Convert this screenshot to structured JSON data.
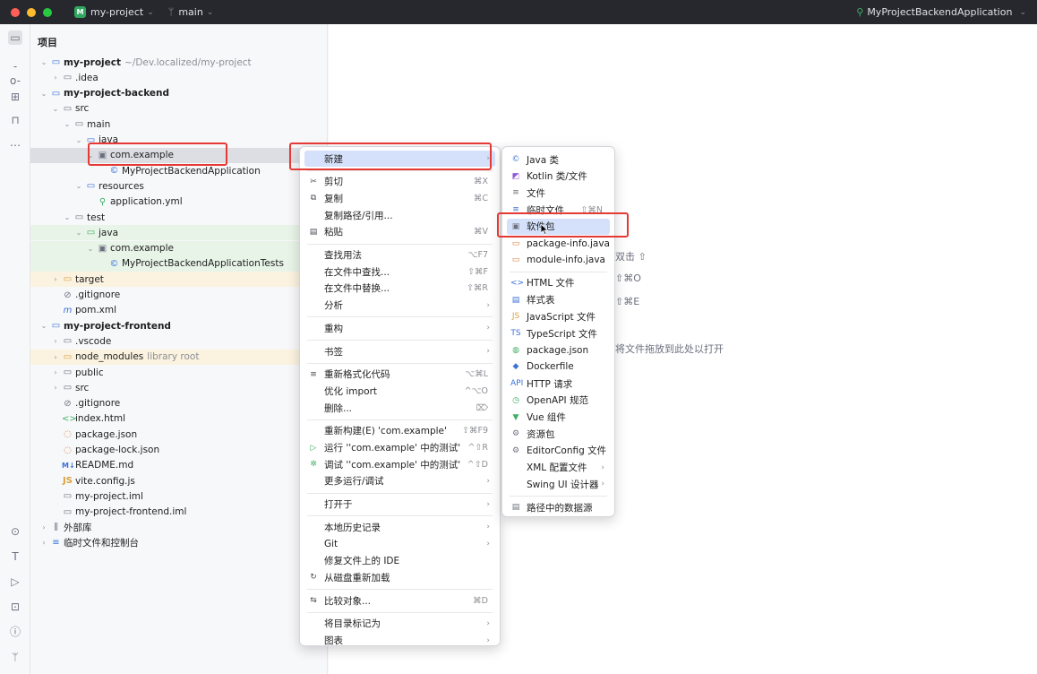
{
  "titlebar": {
    "project": "my-project",
    "project_badge": "M",
    "branch": "main",
    "run_config": "MyProjectBackendApplication"
  },
  "panel": {
    "title": "项目"
  },
  "tree": [
    {
      "label": "my-project",
      "suffix": "~/Dev.localized/my-project",
      "icon": "module-folder-icon",
      "depth": 0,
      "arrow": "down",
      "bold": true
    },
    {
      "label": ".idea",
      "icon": "folder-icon",
      "depth": 1,
      "arrow": "right"
    },
    {
      "label": "my-project-backend",
      "icon": "module-folder-icon",
      "depth": 0,
      "arrow": "down",
      "bold": true
    },
    {
      "label": "src",
      "icon": "folder-icon",
      "depth": 1,
      "arrow": "down"
    },
    {
      "label": "main",
      "icon": "folder-icon",
      "depth": 2,
      "arrow": "down"
    },
    {
      "label": "java",
      "icon": "source-folder-icon",
      "depth": 3,
      "arrow": "down"
    },
    {
      "label": "com.example",
      "icon": "package-icon",
      "depth": 4,
      "arrow": "down",
      "selected": true
    },
    {
      "label": "MyProjectBackendApplication",
      "icon": "spring-class-icon",
      "depth": 5
    },
    {
      "label": "resources",
      "icon": "resources-folder-icon",
      "depth": 3,
      "arrow": "down"
    },
    {
      "label": "application.yml",
      "icon": "yaml-icon",
      "depth": 4
    },
    {
      "label": "test",
      "icon": "folder-icon",
      "depth": 2,
      "arrow": "down"
    },
    {
      "label": "java",
      "icon": "test-folder-icon",
      "depth": 3,
      "arrow": "down",
      "green": true
    },
    {
      "label": "com.example",
      "icon": "package-icon",
      "depth": 4,
      "arrow": "down",
      "green": true
    },
    {
      "label": "MyProjectBackendApplicationTests",
      "icon": "test-class-icon",
      "depth": 5,
      "green": true
    },
    {
      "label": "target",
      "icon": "excluded-folder-icon",
      "depth": 1,
      "arrow": "right",
      "orange": true
    },
    {
      "label": ".gitignore",
      "icon": "gitignore-icon",
      "depth": 1
    },
    {
      "label": "pom.xml",
      "icon": "maven-icon",
      "depth": 1
    },
    {
      "label": "my-project-frontend",
      "icon": "module-folder-icon",
      "depth": 0,
      "arrow": "down",
      "bold": true
    },
    {
      "label": ".vscode",
      "icon": "folder-icon",
      "depth": 1,
      "arrow": "right"
    },
    {
      "label": "node_modules",
      "suffix": "library root",
      "icon": "excluded-folder-icon",
      "depth": 1,
      "arrow": "right",
      "orange": true
    },
    {
      "label": "public",
      "icon": "folder-icon",
      "depth": 1,
      "arrow": "right"
    },
    {
      "label": "src",
      "icon": "folder-icon",
      "depth": 1,
      "arrow": "right"
    },
    {
      "label": ".gitignore",
      "icon": "gitignore-icon",
      "depth": 1
    },
    {
      "label": "index.html",
      "icon": "html-icon",
      "depth": 1
    },
    {
      "label": "package.json",
      "icon": "json-icon",
      "depth": 1
    },
    {
      "label": "package-lock.json",
      "icon": "json-icon",
      "depth": 1
    },
    {
      "label": "README.md",
      "icon": "markdown-icon",
      "depth": 1
    },
    {
      "label": "vite.config.js",
      "icon": "js-icon",
      "depth": 1
    },
    {
      "label": "my-project.iml",
      "icon": "iml-icon",
      "depth": 1
    },
    {
      "label": "my-project-frontend.iml",
      "icon": "iml-icon",
      "depth": 1
    },
    {
      "label": "外部库",
      "icon": "library-icon",
      "depth": 0,
      "arrow": "right"
    },
    {
      "label": "临时文件和控制台",
      "icon": "scratch-icon",
      "depth": 0,
      "arrow": "right"
    }
  ],
  "editor_hints": {
    "hint1": "双击 ⇧",
    "hint2": "⇧⌘O",
    "hint3": "⇧⌘E",
    "hint4": "将文件拖放到此处以打开"
  },
  "context_menu": [
    {
      "label": "新建",
      "icon": "",
      "key": "",
      "submenu": true,
      "highlight": true
    },
    {
      "sep": true
    },
    {
      "label": "剪切",
      "icon": "cut-icon",
      "key": "⌘X"
    },
    {
      "label": "复制",
      "icon": "copy-icon",
      "key": "⌘C"
    },
    {
      "label": "复制路径/引用...",
      "icon": "",
      "key": ""
    },
    {
      "label": "粘贴",
      "icon": "paste-icon",
      "key": "⌘V"
    },
    {
      "sep": true
    },
    {
      "label": "查找用法",
      "icon": "",
      "key": "⌥F7"
    },
    {
      "label": "在文件中查找...",
      "icon": "",
      "key": "⇧⌘F"
    },
    {
      "label": "在文件中替换...",
      "icon": "",
      "key": "⇧⌘R"
    },
    {
      "label": "分析",
      "icon": "",
      "submenu": true
    },
    {
      "sep": true
    },
    {
      "label": "重构",
      "icon": "",
      "submenu": true
    },
    {
      "sep": true
    },
    {
      "label": "书签",
      "icon": "",
      "submenu": true
    },
    {
      "sep": true
    },
    {
      "label": "重新格式化代码",
      "icon": "reformat-icon",
      "key": "⌥⌘L"
    },
    {
      "label": "优化 import",
      "icon": "",
      "key": "^⌥O"
    },
    {
      "label": "删除...",
      "icon": "",
      "key": "⌦"
    },
    {
      "sep": true
    },
    {
      "label": "重新构建(E) 'com.example'",
      "icon": "",
      "key": "⇧⌘F9"
    },
    {
      "label": "运行 ''com.example' 中的测试'",
      "icon": "run-icon",
      "key": "^⇧R"
    },
    {
      "label": "调试 ''com.example' 中的测试'",
      "icon": "debug-icon",
      "key": "^⇧D"
    },
    {
      "label": "更多运行/调试",
      "icon": "",
      "submenu": true
    },
    {
      "sep": true
    },
    {
      "label": "打开于",
      "icon": "",
      "submenu": true
    },
    {
      "sep": true
    },
    {
      "label": "本地历史记录",
      "icon": "",
      "submenu": true
    },
    {
      "label": "Git",
      "icon": "",
      "submenu": true
    },
    {
      "label": "修复文件上的 IDE",
      "icon": ""
    },
    {
      "label": "从磁盘重新加载",
      "icon": "reload-icon"
    },
    {
      "sep": true
    },
    {
      "label": "比较对象...",
      "icon": "compare-icon",
      "key": "⌘D"
    },
    {
      "sep": true
    },
    {
      "label": "将目录标记为",
      "icon": "",
      "submenu": true
    },
    {
      "label": "图表",
      "icon": "",
      "submenu": true
    }
  ],
  "new_submenu": [
    {
      "label": "Java 类",
      "icon": "java-class-icon",
      "glyph": "©",
      "color": "#3a72d9"
    },
    {
      "label": "Kotlin 类/文件",
      "icon": "kotlin-icon",
      "glyph": "◩",
      "color": "#8e5ad9"
    },
    {
      "label": "文件",
      "icon": "file-icon",
      "glyph": "≡",
      "color": "#6c707e"
    },
    {
      "label": "临时文件",
      "icon": "scratch-file-icon",
      "glyph": "≡",
      "color": "#3a72d9",
      "key": "⇧⌘N"
    },
    {
      "label": "软件包",
      "icon": "package-icon",
      "glyph": "▣",
      "color": "#6c707e",
      "highlight": true
    },
    {
      "label": "package-info.java",
      "icon": "package-info-icon",
      "glyph": "▭",
      "color": "#d97c3a"
    },
    {
      "label": "module-info.java",
      "icon": "module-info-icon",
      "glyph": "▭",
      "color": "#d97c3a"
    },
    {
      "sep": true
    },
    {
      "label": "HTML 文件",
      "icon": "html-icon",
      "glyph": "<>",
      "color": "#3a72d9"
    },
    {
      "label": "样式表",
      "icon": "css-icon",
      "glyph": "▤",
      "color": "#3a72d9"
    },
    {
      "label": "JavaScript 文件",
      "icon": "js-icon",
      "glyph": "JS",
      "color": "#d9a23a"
    },
    {
      "label": "TypeScript 文件",
      "icon": "ts-icon",
      "glyph": "TS",
      "color": "#3a72d9"
    },
    {
      "label": "package.json",
      "icon": "npm-icon",
      "glyph": "◍",
      "color": "#3fae66"
    },
    {
      "label": "Dockerfile",
      "icon": "docker-icon",
      "glyph": "◆",
      "color": "#3a72d9"
    },
    {
      "label": "HTTP 请求",
      "icon": "http-icon",
      "glyph": "API",
      "color": "#3a72d9"
    },
    {
      "label": "OpenAPI 规范",
      "icon": "openapi-icon",
      "glyph": "◷",
      "color": "#3fae66"
    },
    {
      "label": "Vue 组件",
      "icon": "vue-icon",
      "glyph": "▼",
      "color": "#3fae66"
    },
    {
      "label": "资源包",
      "icon": "resource-bundle-icon",
      "glyph": "⚙",
      "color": "#6c707e"
    },
    {
      "label": "EditorConfig 文件",
      "icon": "editorconfig-icon",
      "glyph": "⚙",
      "color": "#6c707e"
    },
    {
      "label": "XML 配置文件",
      "icon": "",
      "glyph": "",
      "color": "#6c707e",
      "submenu": true
    },
    {
      "label": "Swing UI 设计器",
      "icon": "",
      "glyph": "",
      "color": "#6c707e",
      "submenu": true
    },
    {
      "sep": true
    },
    {
      "label": "路径中的数据源",
      "icon": "datasource-icon",
      "glyph": "▤",
      "color": "#6c707e"
    }
  ]
}
